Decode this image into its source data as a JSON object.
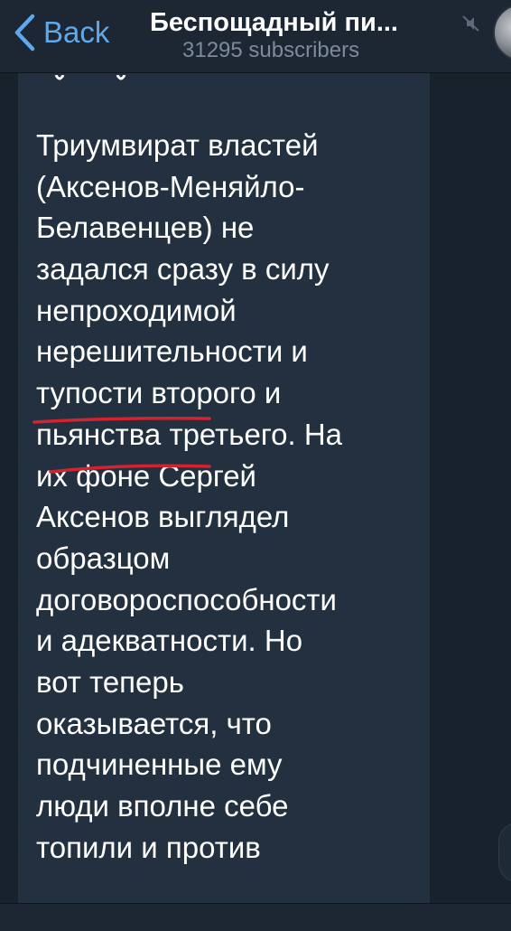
{
  "header": {
    "back_label": "Back",
    "title": "Беспощадный пи...",
    "subtitle": "31295 subscribers",
    "mute_icon": "muted-bell-icon",
    "avatar_icon": "channel-avatar"
  },
  "message": {
    "lines": [
      "Триумвират властей",
      "(Аксенов-Меняйло-",
      "Белавенцев) не",
      "задался сразу в силу",
      "непроходимой",
      "нерешительности и",
      "тупости второго и",
      "пьянства третьего. На",
      "их фоне Сергей",
      "Аксенов выглядел",
      "образцом",
      "договороспособности",
      "и адекватности. Но",
      "вот теперь",
      "оказывается, что",
      "подчиненные ему",
      "люди вполне себе",
      "топили и против"
    ]
  },
  "colors": {
    "accent": "#5fa8ec",
    "background": "#18222d",
    "bubble": "#223040",
    "underline": "#d4232e"
  }
}
